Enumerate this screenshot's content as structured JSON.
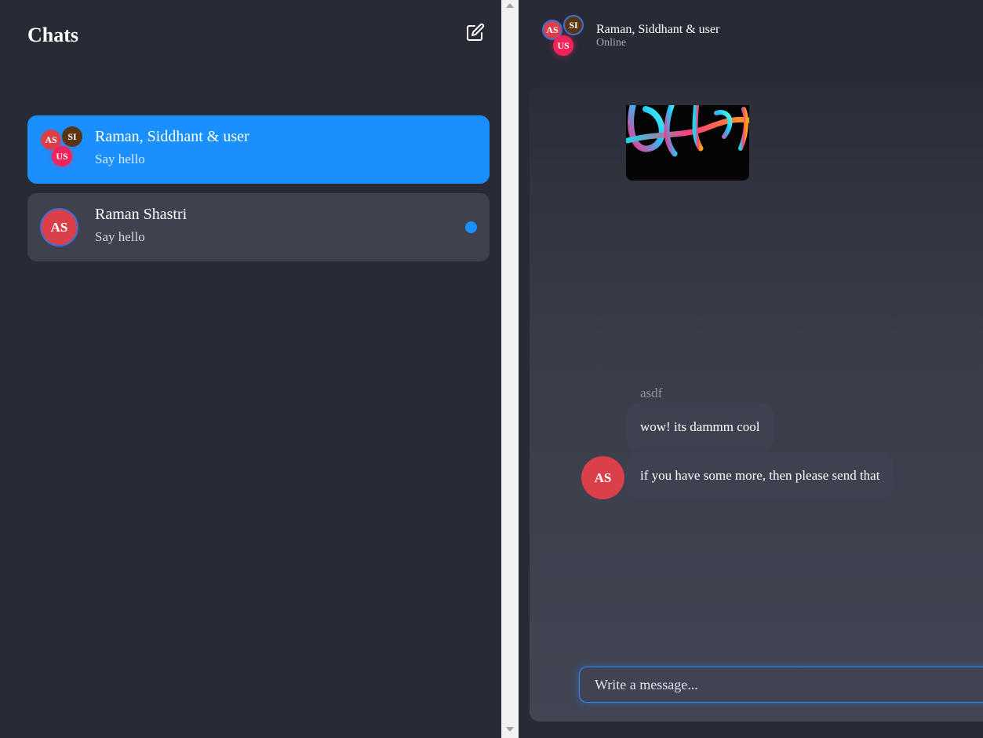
{
  "sidebar": {
    "title": "Chats",
    "compose_icon": "edit-square-icon",
    "chats": [
      {
        "name": "Raman, Siddhant & user",
        "preview": "Say hello",
        "avatars": [
          "AS",
          "SI",
          "US"
        ],
        "active": true
      },
      {
        "name": "Raman Shastri",
        "preview": "Say hello",
        "avatars": [
          "AS"
        ],
        "unread": true
      }
    ]
  },
  "conversation": {
    "header": {
      "name": "Raman, Siddhant & user",
      "status": "Online",
      "avatars": [
        "AS",
        "SI",
        "US"
      ]
    },
    "messages": {
      "sender": "asdf",
      "sender_avatar": "AS",
      "items": [
        "wow! its dammm cool",
        "if you have some more, then please send that"
      ]
    },
    "input": {
      "placeholder": "Write a message..."
    }
  },
  "colors": {
    "accent": "#1a90ff",
    "background": "#282a36",
    "card": "#3f414f",
    "avatar_as": "#d9404a",
    "avatar_si": "#5a3410",
    "avatar_us": "#f0245a"
  }
}
